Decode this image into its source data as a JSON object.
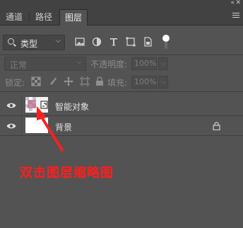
{
  "window": {
    "collapse_glyph": "«",
    "close_glyph": "✕"
  },
  "tabs": [
    {
      "label": "通道",
      "active": false
    },
    {
      "label": "路径",
      "active": false
    },
    {
      "label": "图层",
      "active": true
    }
  ],
  "filter": {
    "type_label": "类型",
    "icons": [
      "image-filter-icon",
      "adjustment-filter-icon",
      "type-filter-icon",
      "shape-filter-icon",
      "smart-object-filter-icon",
      "filter-toggle-icon"
    ]
  },
  "blend": {
    "mode_label": "正常",
    "opacity_label": "不透明度:",
    "opacity_value": "100%"
  },
  "lock": {
    "label": "锁定:",
    "icons": [
      "lock-transparent-icon",
      "lock-paint-icon",
      "lock-position-icon",
      "lock-artboard-icon",
      "lock-all-icon"
    ],
    "fill_label": "填充:",
    "fill_value": "100%"
  },
  "layers": [
    {
      "name": "智能对象",
      "visible": true,
      "type": "smart-object"
    },
    {
      "name": "背景",
      "visible": true,
      "type": "background",
      "locked": true
    }
  ],
  "annotation": {
    "text": "双击图层缩略图",
    "color": "#ff1e1e"
  },
  "colors": {
    "panel_bg": "#535353",
    "tab_bar_bg": "#424242",
    "accent_red": "#ff1e1e"
  }
}
